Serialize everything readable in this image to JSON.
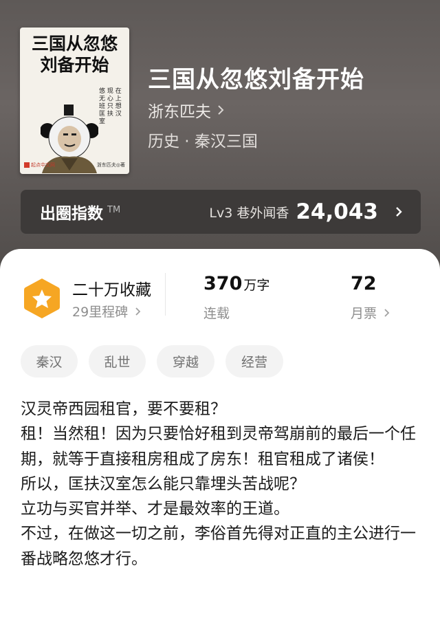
{
  "book": {
    "title": "三国从忽悠刘备开始",
    "author": "浙东匹夫",
    "genre": "历史 · 秦汉三国",
    "cover": {
      "title_line1": "三国从忽悠",
      "title_line2": "刘备开始",
      "slogan": "悠 现 在 无 心 上 班 只 想 匡 扶 汉 室",
      "publisher": "起点中文网",
      "author_credit": "浙东匹夫◎著"
    }
  },
  "index": {
    "label": "出圈指数",
    "tm": "TM",
    "level": "Lv3 巷外闻香",
    "value": "24,043"
  },
  "stats": {
    "collection": {
      "title": "二十万收藏",
      "sub": "29里程碑"
    },
    "words": {
      "number": "370",
      "unit": "万字",
      "sub": "连载"
    },
    "votes": {
      "number": "72",
      "sub": "月票"
    }
  },
  "tags": [
    "秦汉",
    "乱世",
    "穿越",
    "经营"
  ],
  "description": [
    "汉灵帝西园租官，要不要租？",
    "租！当然租！因为只要恰好租到灵帝驾崩前的最后一个任期，就等于直接租房租成了房东！租官租成了诸侯！",
    "所以，匡扶汉室怎么能只靠埋头苦战呢？",
    "立功与买官并举、才是最效率的王道。",
    "不过，在做这一切之前，李俗首先得对正直的主公进行一番战略忽悠才行。"
  ],
  "colors": {
    "hero_bg": "#5e5957",
    "index_bar_bg": "#3d3a39",
    "badge_orange": "#f6a623",
    "tag_bg": "#f3f3f3"
  },
  "icons": {
    "author_chevron": "chevron-right-icon",
    "index_chevron": "chevron-right-icon",
    "badge": "star-hexagon-icon"
  }
}
